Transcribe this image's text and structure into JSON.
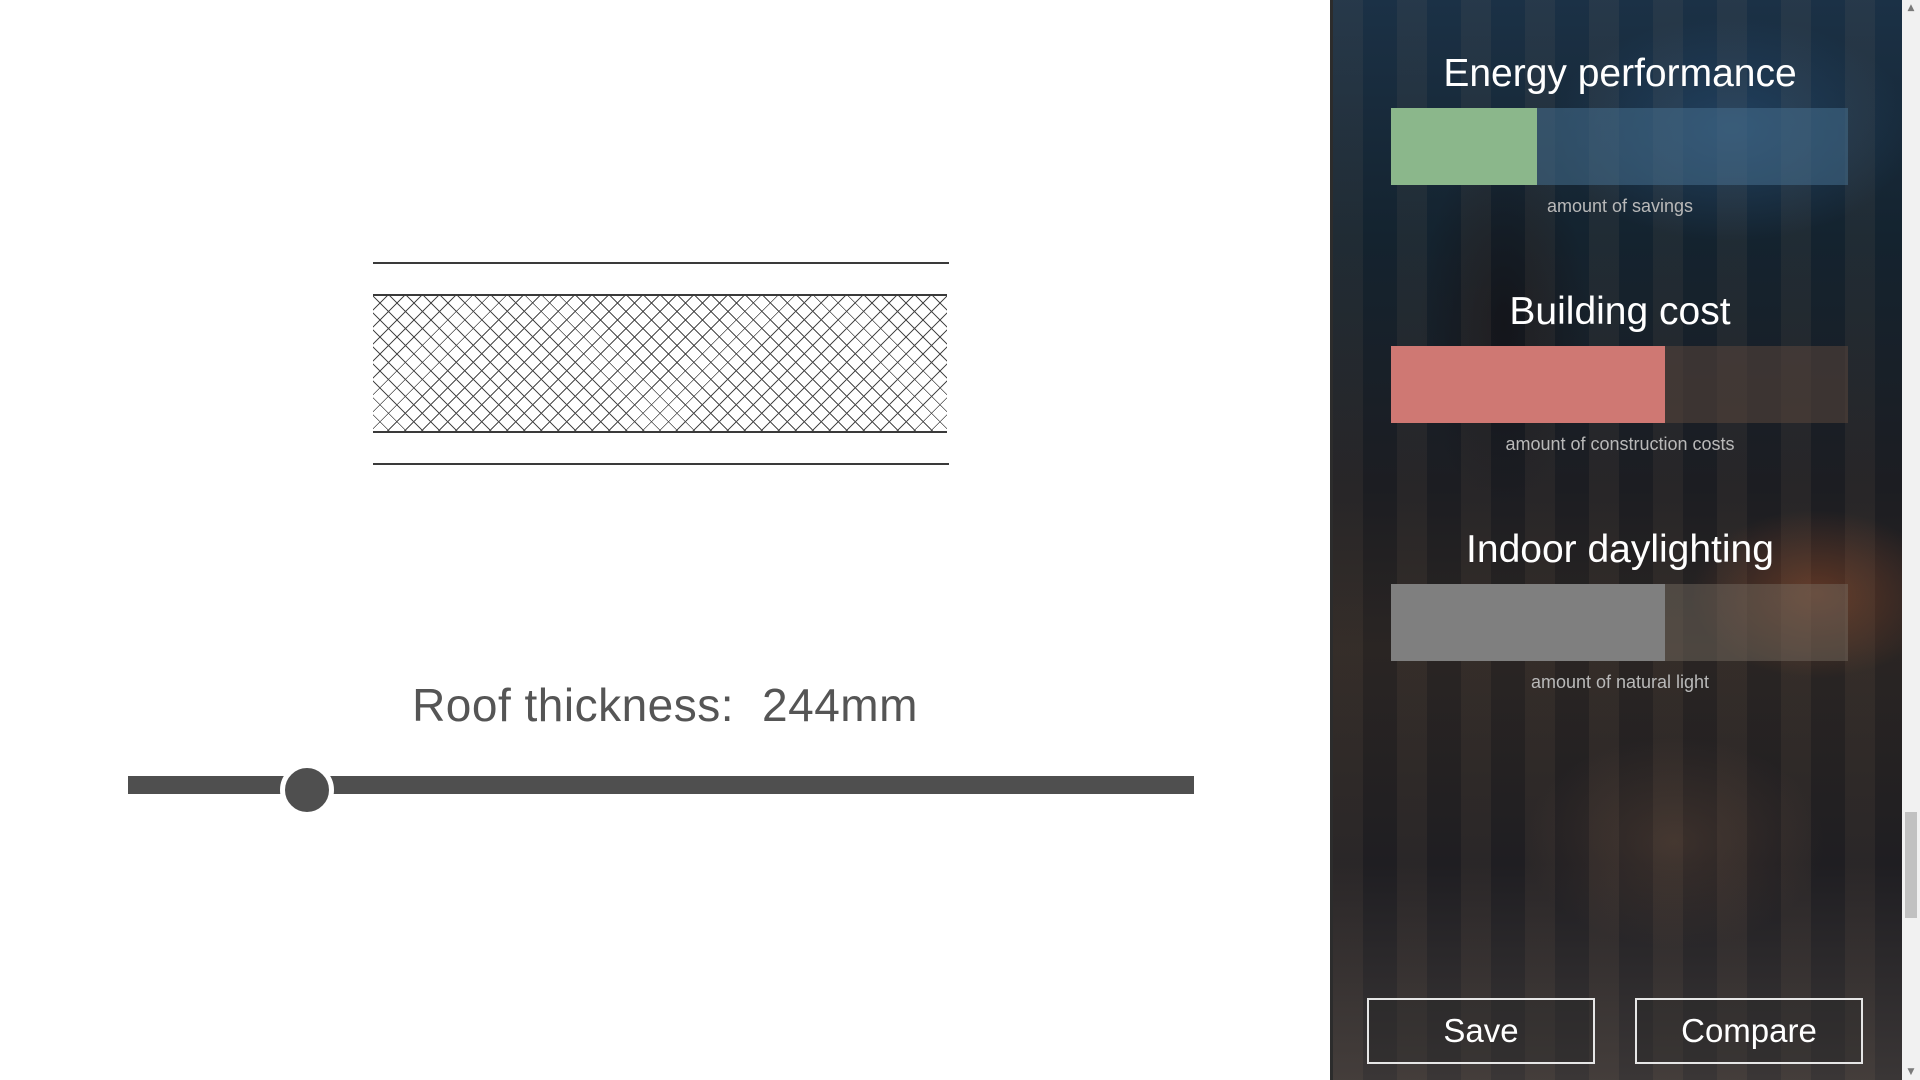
{
  "design": {
    "roof_label": "Roof thickness:",
    "roof_value": "244mm",
    "slider": {
      "value_fraction": 0.163
    }
  },
  "panel": {
    "metrics": [
      {
        "title": "Energy performance",
        "caption": "amount of savings",
        "level": 0.32,
        "fill_color": "#8bb78b",
        "track_color": "rgba(70,110,140,0.55)"
      },
      {
        "title": "Building cost",
        "caption": "amount of construction costs",
        "level": 0.6,
        "fill_color": "#cf7873",
        "track_color": "rgba(90,70,60,0.55)"
      },
      {
        "title": "Indoor daylighting",
        "caption": "amount of natural light",
        "level": 0.6,
        "fill_color": "#7f7f7f",
        "track_color": "rgba(120,110,100,0.45)"
      }
    ],
    "buttons": {
      "save": "Save",
      "compare": "Compare"
    }
  },
  "scrollbar": {
    "up_icon": "▲",
    "down_icon": "▼"
  }
}
